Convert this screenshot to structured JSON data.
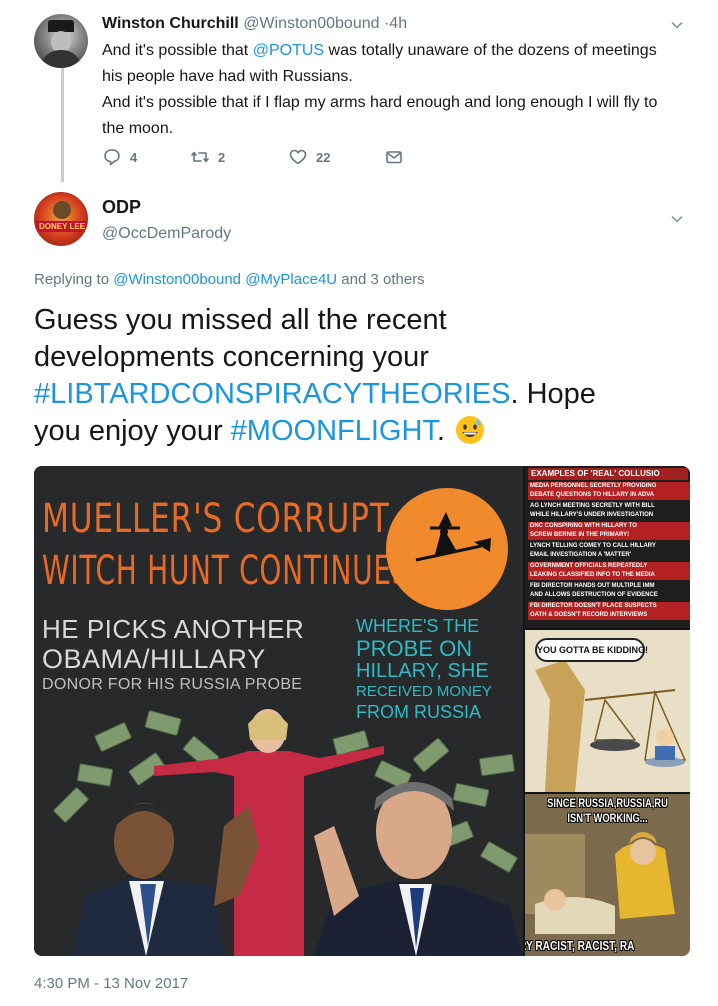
{
  "parent_tweet": {
    "name": "Winston Churchill",
    "handle": "@Winston00bound",
    "time": "·4h",
    "text_lines": [
      [
        "And it's possible that ",
        "@POTUS",
        " was totally unaware of the dozens of meetings"
      ],
      "his people have had with Russians.",
      "And it's possible that if I flap my arms hard enough and long enough I will fly to",
      "the moon."
    ],
    "replies": "4",
    "retweets": "2",
    "likes": "22"
  },
  "main_tweet": {
    "name": "ODP",
    "handle": "@OccDemParody",
    "avatar_text": "DONEY LEE",
    "replying_prefix": "Replying to ",
    "replying_mentions": [
      "@Winston00bound",
      "@MyPlace4U"
    ],
    "replying_suffix": " and 3 others",
    "text_lines": [
      "Guess you missed all the recent",
      "developments concerning your",
      [
        "#LIBTARDCONSPIRACYTHEORIES",
        ". Hope"
      ],
      [
        "you enjoy your ",
        "#MOONFLIGHT",
        "."
      ]
    ],
    "emoji": "grinning-face-with-sweat",
    "timestamp": "4:30 PM - 13 Nov 2017"
  },
  "media": {
    "main": {
      "headline_1": "MUELLER'S CORRUPT",
      "headline_2": "WITCH HUNT CONTINUES",
      "left_1": "HE PICKS ANOTHER",
      "left_2": "OBAMA/HILLARY",
      "left_3": "DONOR FOR HIS RUSSIA PROBE",
      "right_1": "WHERE'S THE",
      "right_2": "PROBE ON",
      "right_3": "HILLARY, SHE",
      "right_4": "RECEIVED MONEY",
      "right_5": "FROM RUSSIA"
    },
    "side1": {
      "title": "EXAMPLES OF 'REAL' COLLUSIO",
      "rows": [
        "MEDIA PERSONNEL SECRETLY PROVIDING",
        "DEBATE QUESTIONS TO HILLARY IN ADVA",
        "AG LYNCH MEETING SECRETLY WITH BILL",
        "WHILE HILLARY'S UNDER INVESTIGATION",
        "DNC CONSPIRING WITH HILLARY TO",
        "SCREW BERNIE IN THE PRIMARY!",
        "LYNCH TELLING COMEY TO CALL HILLARY",
        "EMAIL INVESTIGATION A 'MATTER'",
        "GOVERNMENT OFFICIALS REPEATEDLY",
        "LEAKING CLASSIFIED INFO TO THE MEDIA",
        "FBI DIRECTOR HANDS OUT MULTIPLE IMM",
        "AND ALLOWS DESTRUCTION OF EVIDENCE",
        "FBI DIRECTOR DOESN'T PLACE SUSPECTS",
        "OATH & DOESN'T RECORD INTERVIEWS"
      ]
    },
    "side2": {
      "bubble": "YOU GOTTA BE KIDDING!"
    },
    "side3": {
      "top_1": "SINCE RUSSIA,RUSSIA,RU",
      "top_2": "ISN'T WORKING...",
      "bottom": "RY RACIST, RACIST, RA"
    }
  },
  "colors": {
    "link": "#1b95e0",
    "secondary_text": "#657786",
    "headline_orange": "#e86a24",
    "teal_text": "#2dbbc6"
  }
}
